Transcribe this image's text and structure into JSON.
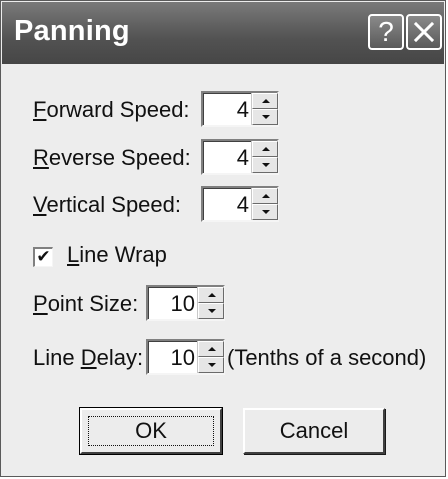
{
  "window": {
    "title": "Panning",
    "help_label": "?",
    "close_label": "✕"
  },
  "fields": {
    "forward_speed": {
      "label_pre": "",
      "label_accel": "F",
      "label_post": "orward Speed:",
      "value": "4"
    },
    "reverse_speed": {
      "label_pre": "",
      "label_accel": "R",
      "label_post": "everse Speed:",
      "value": "4"
    },
    "vertical_speed": {
      "label_pre": "",
      "label_accel": "V",
      "label_post": "ertical Speed:",
      "value": "4"
    },
    "line_wrap": {
      "label_pre": "",
      "label_accel": "L",
      "label_post": "ine Wrap",
      "checked": true,
      "mark": "✔"
    },
    "point_size": {
      "label_pre": "",
      "label_accel": "P",
      "label_post": "oint Size:",
      "value": "10"
    },
    "line_delay": {
      "label_pre": "Line ",
      "label_accel": "D",
      "label_post": "elay:",
      "value": "10",
      "suffix": "(Tenths of a second)"
    }
  },
  "buttons": {
    "ok_label": "OK",
    "cancel_label": "Cancel"
  }
}
